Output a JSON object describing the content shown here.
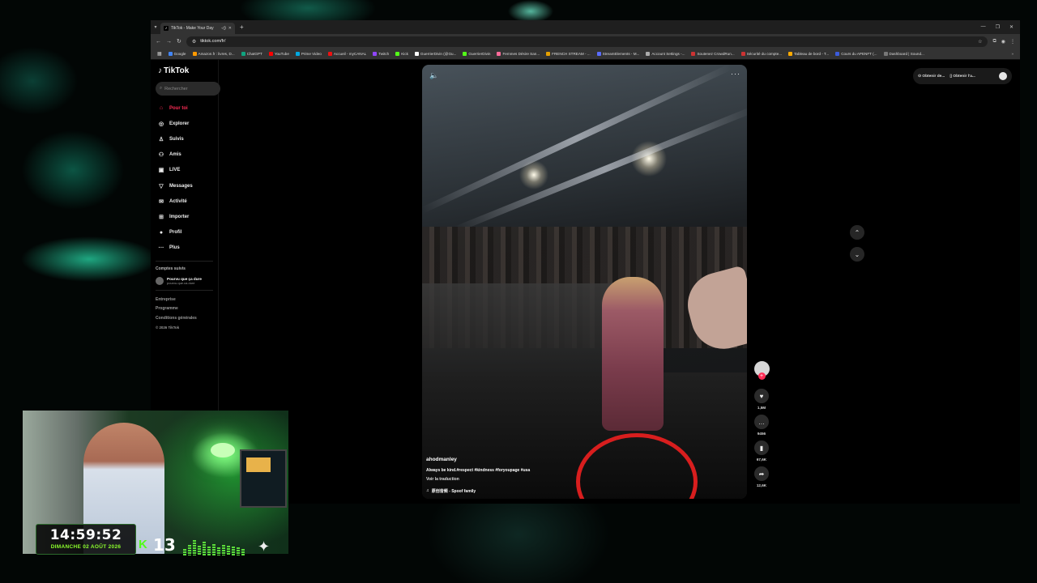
{
  "browser": {
    "tab_title": "TikTok - Make Your Day",
    "tab_favicon": "♪",
    "url": "tiktok.com/fr/",
    "bookmarks": [
      {
        "label": "Google",
        "color": "#4285f4"
      },
      {
        "label": "Amazon.fr : livres, D...",
        "color": "#ff9900"
      },
      {
        "label": "ChatGPT",
        "color": "#10a37f"
      },
      {
        "label": "YouTube",
        "color": "#ff0000"
      },
      {
        "label": "Prime Video",
        "color": "#00a8e1"
      },
      {
        "label": "Accueil - myCANAL",
        "color": "#e11"
      },
      {
        "label": "Twitch",
        "color": "#9146ff"
      },
      {
        "label": "Kick",
        "color": "#53fc18"
      },
      {
        "label": "GuerrierDivin (@Gu...",
        "color": "#ffffff"
      },
      {
        "label": "GuerrierDivin",
        "color": "#53fc18"
      },
      {
        "label": "Femmes Désire San...",
        "color": "#ff6b9a"
      },
      {
        "label": "FRENCH STREAM - ...",
        "color": "#e6a000"
      },
      {
        "label": "StreamElements - M...",
        "color": "#5a6cff"
      },
      {
        "label": "Account Settings -...",
        "color": "#aaaaaa"
      },
      {
        "label": "Soutenez CrowdRun...",
        "color": "#cc3333"
      },
      {
        "label": "Sécurité du compte...",
        "color": "#cc3333"
      },
      {
        "label": "Tableau de bord - T...",
        "color": "#ffaa00"
      },
      {
        "label": "Cours du APENFT (...",
        "color": "#3b5bdb"
      },
      {
        "label": "Dashboard | Sound...",
        "color": "#777777"
      }
    ]
  },
  "tiktok": {
    "logo": "TikTok",
    "search_placeholder": "Rechercher",
    "nav": [
      {
        "label": "Pour toi",
        "icon": "⌂",
        "name": "home-icon",
        "active": true
      },
      {
        "label": "Explorer",
        "icon": "◎",
        "name": "compass-icon"
      },
      {
        "label": "Suivis",
        "icon": "♙",
        "name": "following-icon"
      },
      {
        "label": "Amis",
        "icon": "⚇",
        "name": "friends-icon"
      },
      {
        "label": "LIVE",
        "icon": "▣",
        "name": "live-icon"
      },
      {
        "label": "Messages",
        "icon": "▽",
        "name": "messages-icon"
      },
      {
        "label": "Activité",
        "icon": "✉",
        "name": "activity-icon"
      },
      {
        "label": "Importer",
        "icon": "⊞",
        "name": "upload-icon"
      },
      {
        "label": "Profil",
        "icon": "●",
        "name": "profile-icon"
      },
      {
        "label": "Plus",
        "icon": "···",
        "name": "more-icon"
      }
    ],
    "followed_title": "Comptes suivis",
    "followed": [
      {
        "name": "Pourvu que ça dure",
        "handle": "pourvu.que.ca.dure"
      }
    ],
    "footer": [
      "Entreprise",
      "Programme",
      "Conditions générales"
    ],
    "copyright": "© 2026 TikTok",
    "top_right": {
      "item1": "Obtenir de...",
      "item2": "Obtenir l'a..."
    },
    "video": {
      "author": "ahodmanley",
      "caption": "Always be kind.#respect #kindness #foryoupage #usa",
      "translate": "Voir la traduction",
      "music": "原创音频 - Spoof family"
    },
    "actions": {
      "likes": "1,5M",
      "comments": "9456",
      "saves": "67,6K",
      "shares": "12,6K"
    }
  },
  "overlay": {
    "time": "14:59:52",
    "date": "DIMANCHE 02 AOÛT 2026",
    "kick_icon": "K",
    "viewers": "13",
    "meter_levels": [
      0.35,
      0.55,
      0.8,
      0.5,
      0.7,
      0.45,
      0.6,
      0.4,
      0.55,
      0.5,
      0.45,
      0.4,
      0.35
    ]
  }
}
